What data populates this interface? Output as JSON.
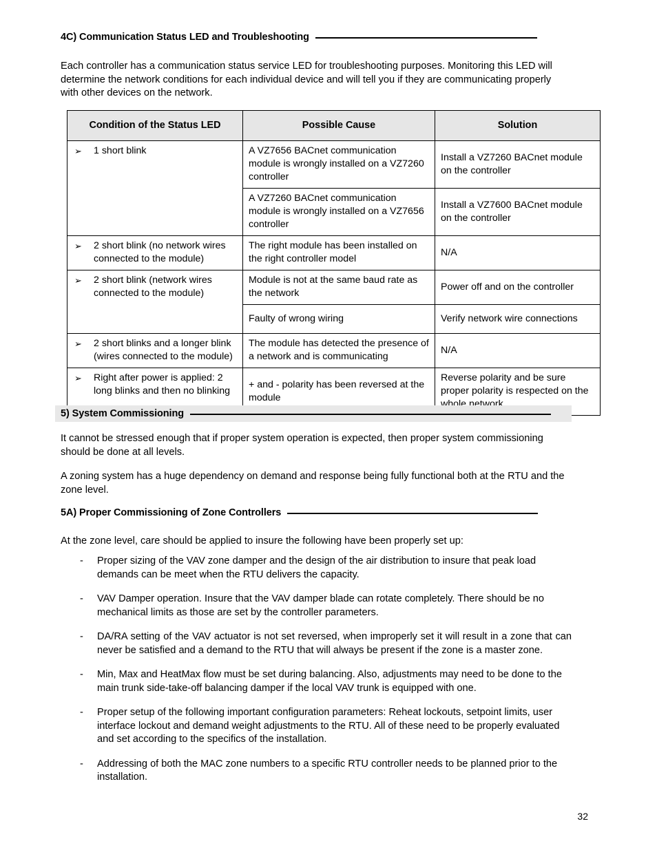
{
  "section_4c": {
    "heading": "4C) Communication Status LED and Troubleshooting",
    "paragraph": "Each controller has a communication status service LED for troubleshooting purposes. Monitoring this LED will determine the network conditions for each individual device and will tell you if they are communicating properly with other devices on the network."
  },
  "table": {
    "columns": [
      "Condition of the Status LED",
      "Possible Cause",
      "Solution"
    ],
    "bullet_glyph": "➢",
    "rows": [
      {
        "condition": "1 short blink",
        "condition_rowspan": 2,
        "cause": "A VZ7656 BACnet communication module is wrongly installed on a VZ7260 controller",
        "solution": "Install a VZ7260 BACnet module on the controller"
      },
      {
        "condition": null,
        "cause": "A VZ7260 BACnet communication module is wrongly installed on a VZ7656 controller",
        "solution": "Install a VZ7600 BACnet module on the controller"
      },
      {
        "condition": "2 short blink (no network wires connected to the module)",
        "condition_rowspan": 1,
        "cause": "The right module has been installed on the right controller model",
        "solution": "N/A"
      },
      {
        "condition": "2 short blink (network wires connected to the module)",
        "condition_rowspan": 2,
        "cause": "Module is not at the same baud rate as the network",
        "solution": "Power off and on the controller"
      },
      {
        "condition": null,
        "cause": "Faulty of wrong wiring",
        "solution": "Verify network wire connections"
      },
      {
        "condition": "2 short blinks and a longer blink (wires connected to the module)",
        "condition_rowspan": 1,
        "cause": "The module has detected the presence of a network and is communicating",
        "solution": "N/A"
      },
      {
        "condition": "Right after power is applied: 2 long blinks and then no blinking",
        "condition_rowspan": 1,
        "cause": "+ and - polarity has been reversed at the module",
        "solution": "Reverse polarity and be sure proper polarity is respected on the whole network"
      }
    ]
  },
  "section_5": {
    "heading": "5) System Commissioning",
    "paragraph_1": "It cannot be stressed enough that if proper system operation is expected, then proper system commissioning should be done at all levels.",
    "paragraph_2": "A zoning system has a huge dependency on demand and response being fully functional both at the RTU and the zone level."
  },
  "section_5a": {
    "heading": "5A) Proper Commissioning of Zone Controllers",
    "intro": "At the zone level, care should be applied to insure the following have been properly set up:",
    "dash_glyph": "-",
    "bullets": [
      "Proper sizing of the VAV zone damper and the design of the air distribution to insure that peak load demands can be meet when the RTU delivers the capacity.",
      "VAV Damper operation. Insure that the VAV damper blade can rotate completely. There should be no mechanical limits as those are set by the controller parameters.",
      "DA/RA setting of the VAV actuator is not set reversed, when improperly set it will result in a zone that can never be satisfied and a demand to the RTU that will always be present if the zone is a master zone.",
      "Min, Max and HeatMax flow must be set during balancing. Also, adjustments may need to be done to the main trunk side-take-off balancing damper if the local VAV trunk is equipped with one.",
      "Proper setup of the following important configuration parameters: Reheat lockouts, setpoint limits, user interface lockout and demand weight adjustments to the RTU. All of these need to be properly evaluated and set according to the specifics of the installation.",
      "Addressing of both the MAC zone numbers to a specific RTU controller needs to be planned prior to the installation."
    ]
  },
  "footer": {
    "page_number": "32"
  },
  "colors": {
    "header_fill": "#e6e6e6",
    "band_fill": "#e8e8e8",
    "rule": "#000000",
    "text": "#000000"
  }
}
